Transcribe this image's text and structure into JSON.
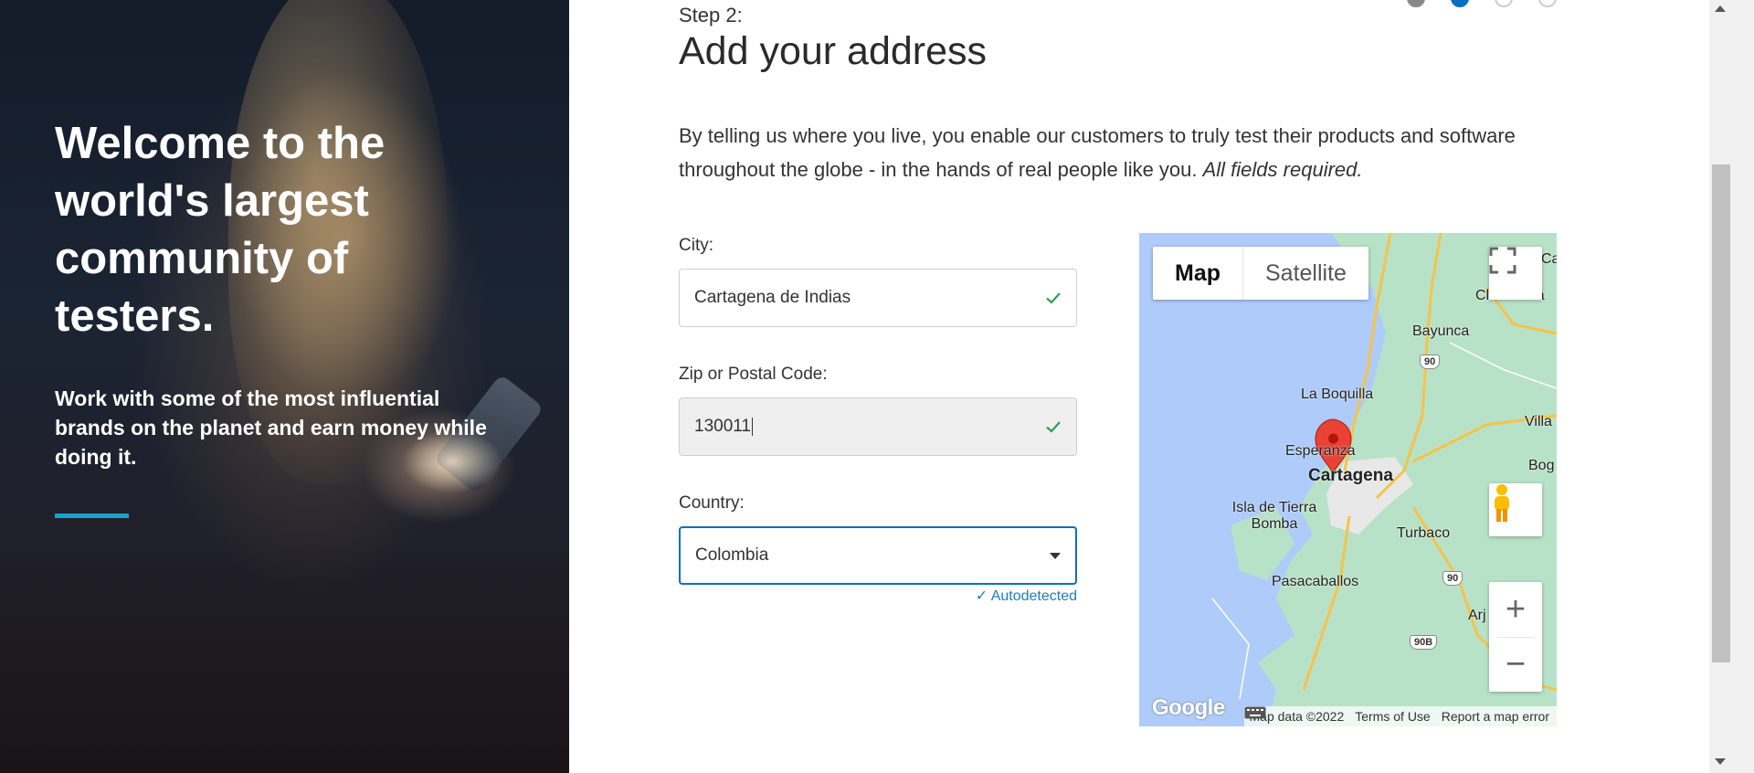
{
  "hero": {
    "title": "Welcome to the world's largest community of testers.",
    "subtitle": "Work with some of the most influential brands on the planet and earn money while doing it."
  },
  "steps": [
    "done",
    "active",
    "pending",
    "pending"
  ],
  "main": {
    "step_label": "Step 2:",
    "title": "Add your address",
    "intro_text": "By telling us where you live, you enable our customers to truly test their products and software throughout the globe - in the hands of real people like you. ",
    "intro_required": "All fields required."
  },
  "form": {
    "city_label": "City:",
    "city_value": "Cartagena de Indias",
    "zip_label": "Zip or Postal Code:",
    "zip_value": "130011",
    "country_label": "Country:",
    "country_value": "Colombia",
    "autodetected": "✓ Autodetected"
  },
  "map": {
    "type_map": "Map",
    "type_satellite": "Satellite",
    "zoom_in": "+",
    "zoom_out": "−",
    "google_logo": "Google",
    "attribution": {
      "data": "Map data ©2022",
      "terms": "Terms of Use",
      "report": "Report a map error"
    },
    "labels": {
      "cartagena": "Cartagena",
      "la_boquilla": "La Boquilla",
      "bayunca": "Bayunca",
      "esperanza": "Esperanza",
      "isla": "Isla de Tierra Bomba",
      "turbaco": "Turbaco",
      "pasacaballos": "Pasacaballos",
      "clemencia": "Clemencia",
      "villa": "Villa",
      "bog": "Bog",
      "arj": "Arj",
      "ca": "Ca"
    },
    "shields": {
      "r90a": "90",
      "r90b": "90",
      "r90c": "90B"
    }
  },
  "colors": {
    "accent": "#0a6fc2",
    "success": "#2e9d58",
    "hero_rule": "#1aa3c9",
    "land": "#b8e2c7",
    "water": "#aecbfa",
    "road": "#f6c34a"
  }
}
